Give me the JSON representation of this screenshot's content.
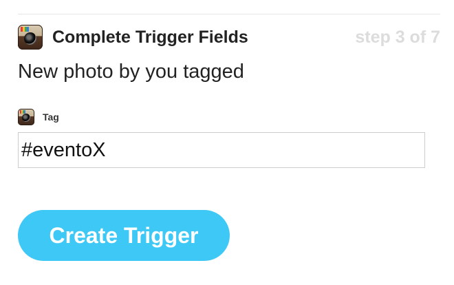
{
  "header": {
    "title": "Complete Trigger Fields",
    "step": "step 3 of 7"
  },
  "trigger": {
    "description": "New photo by you tagged"
  },
  "field": {
    "label": "Tag",
    "value": "#eventoX"
  },
  "actions": {
    "create_label": "Create Trigger"
  },
  "icons": {
    "service": "instagram-camera-icon"
  },
  "colors": {
    "button": "#3ec8f5",
    "step_text": "#dcdcdc",
    "title_text": "#222222"
  }
}
